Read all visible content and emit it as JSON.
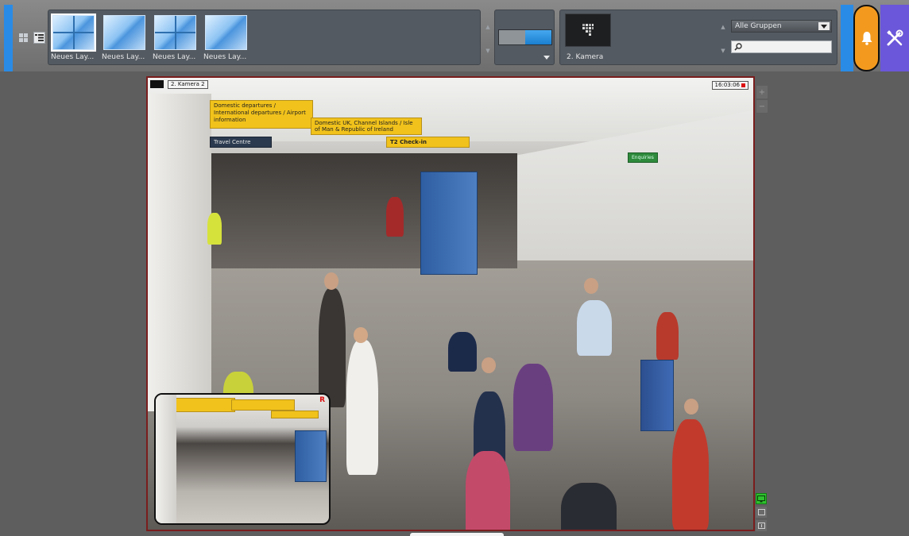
{
  "toolbar": {
    "layouts": [
      {
        "label": "Neues Lay...",
        "type": "quad",
        "selected": true
      },
      {
        "label": "Neues Lay...",
        "type": "single",
        "selected": false
      },
      {
        "label": "Neues Lay...",
        "type": "quad",
        "selected": false
      },
      {
        "label": "Neues Lay...",
        "type": "single",
        "selected": false
      }
    ],
    "camera_thumb_label": "2. Kamera",
    "group_select": {
      "value": "Alle Gruppen"
    },
    "search": {
      "placeholder": ""
    },
    "colors": {
      "accent_blue": "#2a8be6",
      "alarm_orange": "#f39a1e",
      "tools_purple": "#6a57d9"
    },
    "icons": {
      "grid": "grid-icon",
      "list": "list-icon",
      "camera": "camera-icon",
      "search": "search-icon",
      "alarm": "bell-icon",
      "tools": "wrench-screwdriver-icon"
    }
  },
  "viewer": {
    "camera_label": "2. Kamera 2",
    "timestamp": "16:03:06",
    "zoom_in": "+",
    "zoom_out": "−",
    "pip_rec": "R",
    "frame_border_color": "#7a1d1d",
    "signs": [
      "Domestic departures / International departures / Airport information",
      "Domestic UK, Channel Islands / Isle of Man & Republic of Ireland",
      "T2 Check-in",
      "Travel Centre",
      "Enquiries"
    ]
  }
}
